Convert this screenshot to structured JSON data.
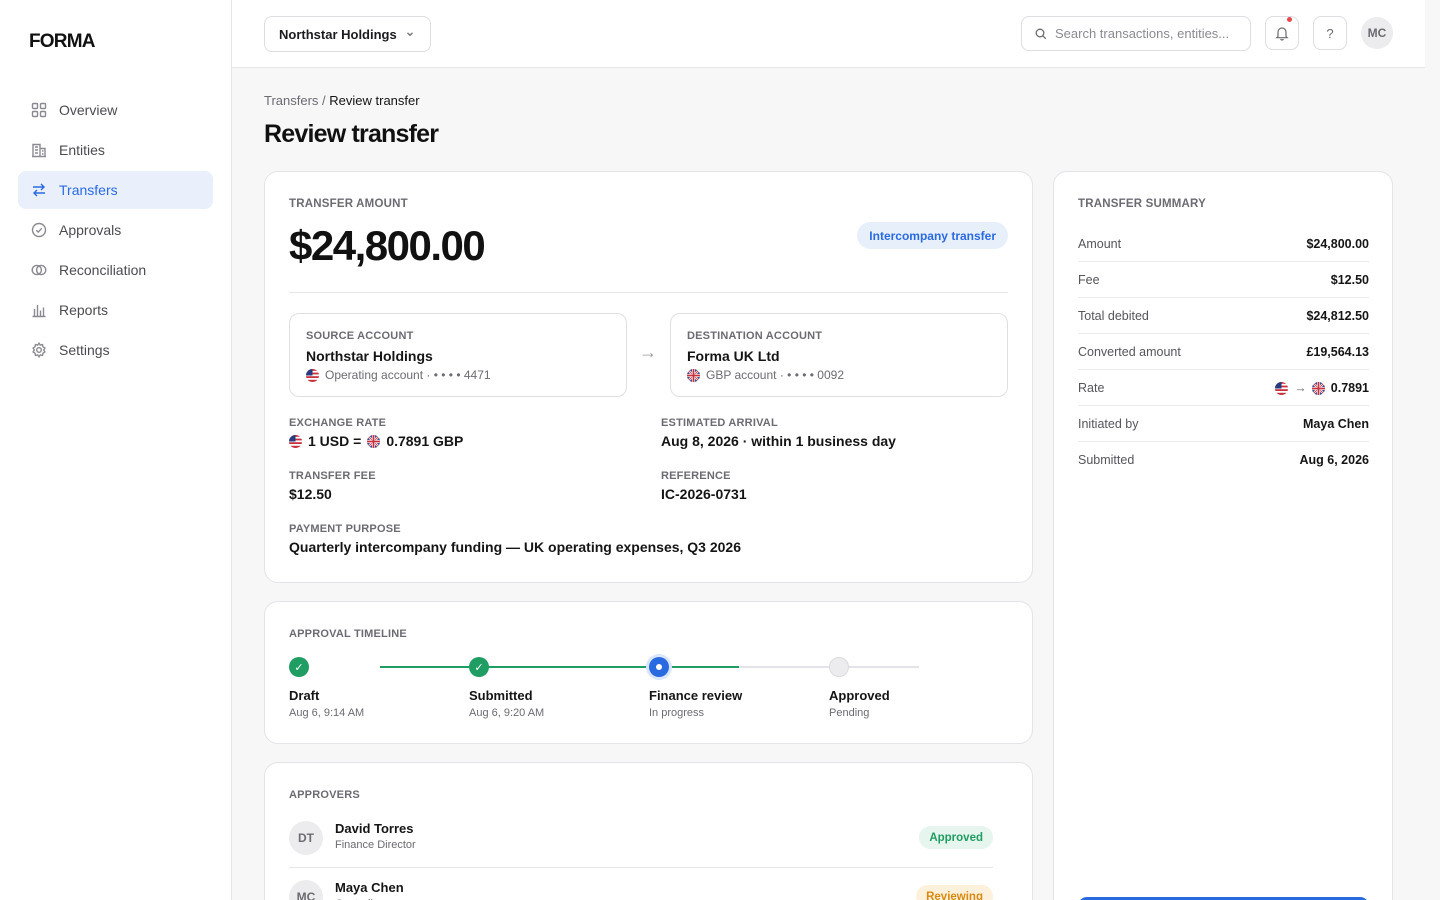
{
  "app": {
    "logo": "FORMA"
  },
  "sidebar": {
    "items": [
      {
        "label": "Overview",
        "icon": "grid-icon"
      },
      {
        "label": "Entities",
        "icon": "building-icon"
      },
      {
        "label": "Transfers",
        "icon": "transfer-arrows-icon",
        "active": true
      },
      {
        "label": "Approvals",
        "icon": "check-circle-icon"
      },
      {
        "label": "Reconciliation",
        "icon": "rings-icon"
      },
      {
        "label": "Reports",
        "icon": "bar-chart-icon"
      },
      {
        "label": "Settings",
        "icon": "gear-icon"
      }
    ]
  },
  "topbar": {
    "org": "Northstar Holdings",
    "search_placeholder": "Search transactions, entities...",
    "help": "?",
    "user_initials": "MC"
  },
  "breadcrumb": {
    "parent": "Transfers",
    "separator": " / ",
    "current": "Review transfer"
  },
  "page": {
    "title": "Review transfer"
  },
  "transfer": {
    "amount_label": "Transfer amount",
    "amount": "$24,800.00",
    "tag": "Intercompany transfer",
    "source": {
      "label": "Source account",
      "name": "Northstar Holdings",
      "detail": "Operating account · • • • • 4471",
      "flag": "us-flag"
    },
    "destination": {
      "label": "Destination account",
      "name": "Forma UK Ltd",
      "detail": "GBP account · • • • • 0092",
      "flag": "uk-flag"
    },
    "arrow": "→",
    "exchange_rate": {
      "label": "Exchange rate",
      "from": "1 USD =",
      "to": "0.7891 GBP"
    },
    "arrival": {
      "label": "Estimated arrival",
      "value": "Aug 8, 2026 · within 1 business day"
    },
    "fee": {
      "label": "Transfer fee",
      "value": "$12.50"
    },
    "reference": {
      "label": "Reference",
      "value": "IC-2026-0731"
    },
    "purpose": {
      "label": "Payment purpose",
      "value": "Quarterly intercompany funding — UK operating expenses, Q3 2026"
    }
  },
  "timeline": {
    "label": "Approval timeline",
    "steps": [
      {
        "title": "Draft",
        "sub": "Aug 6, 9:14 AM",
        "state": "done"
      },
      {
        "title": "Submitted",
        "sub": "Aug 6, 9:20 AM",
        "state": "done"
      },
      {
        "title": "Finance review",
        "sub": "In progress",
        "state": "current"
      },
      {
        "title": "Approved",
        "sub": "Pending",
        "state": "pending"
      }
    ],
    "check": "✓"
  },
  "approvers": {
    "label": "Approvers",
    "list": [
      {
        "initials": "DT",
        "name": "David Torres",
        "role": "Finance Director",
        "status": "Approved"
      },
      {
        "initials": "MC",
        "name": "Maya Chen",
        "role": "Controller",
        "status": "Reviewing"
      }
    ]
  },
  "summary": {
    "label": "Transfer summary",
    "rows": [
      {
        "k": "Amount",
        "v": "$24,800.00"
      },
      {
        "k": "Fee",
        "v": "$12.50"
      },
      {
        "k": "Total debited",
        "v": "$24,812.50"
      },
      {
        "k": "Converted amount",
        "v": "£19,564.13"
      },
      {
        "k": "Rate",
        "v": "0.7891",
        "arrow": "→"
      },
      {
        "k": "Initiated by",
        "v": "Maya Chen"
      },
      {
        "k": "Submitted",
        "v": "Aug 6, 2026"
      }
    ]
  },
  "colors": {
    "accent": "#2a6ae0",
    "success": "#1f9d62",
    "warning": "#d98a12",
    "pending": "#e4e4e8"
  }
}
